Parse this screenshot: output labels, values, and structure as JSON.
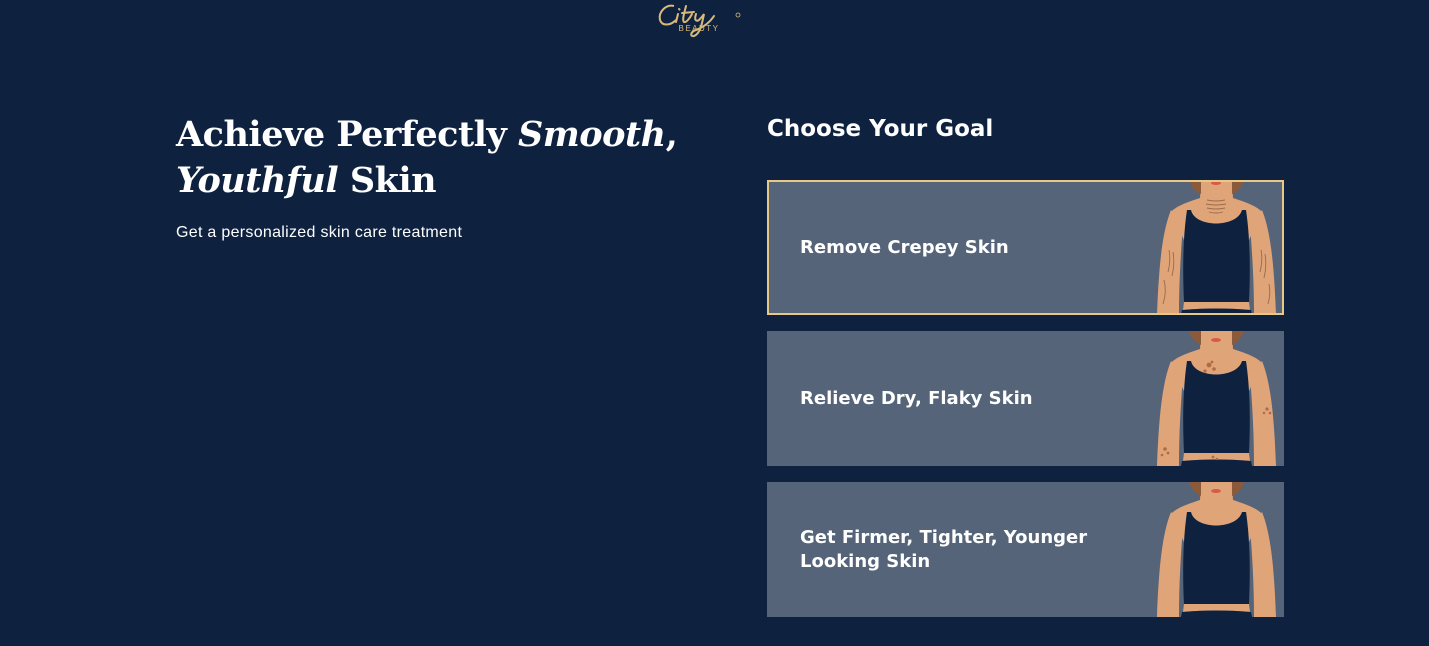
{
  "brand": {
    "logo_script": "City",
    "logo_sub": "BEAUTY"
  },
  "hero": {
    "headline_part1": "Achieve Perfectly ",
    "headline_em1": "Smooth",
    "headline_part2": ", ",
    "headline_em2": "Youthful",
    "headline_part3": " Skin",
    "subtitle": "Get a personalized skin care treatment"
  },
  "goals": {
    "title": "Choose Your Goal",
    "options": [
      {
        "label": "Remove Crepey Skin",
        "selected": true,
        "marks": "crepe-lines"
      },
      {
        "label": "Relieve Dry, Flaky Skin",
        "selected": false,
        "marks": "dry-flakes"
      },
      {
        "label": "Get Firmer, Tighter, Younger Looking Skin",
        "selected": false,
        "marks": "none"
      }
    ]
  },
  "colors": {
    "background": "#0e2240",
    "card": "#556479",
    "accent_gold": "#e6c887",
    "skin": "#e0a479",
    "top": "#0e2240"
  }
}
